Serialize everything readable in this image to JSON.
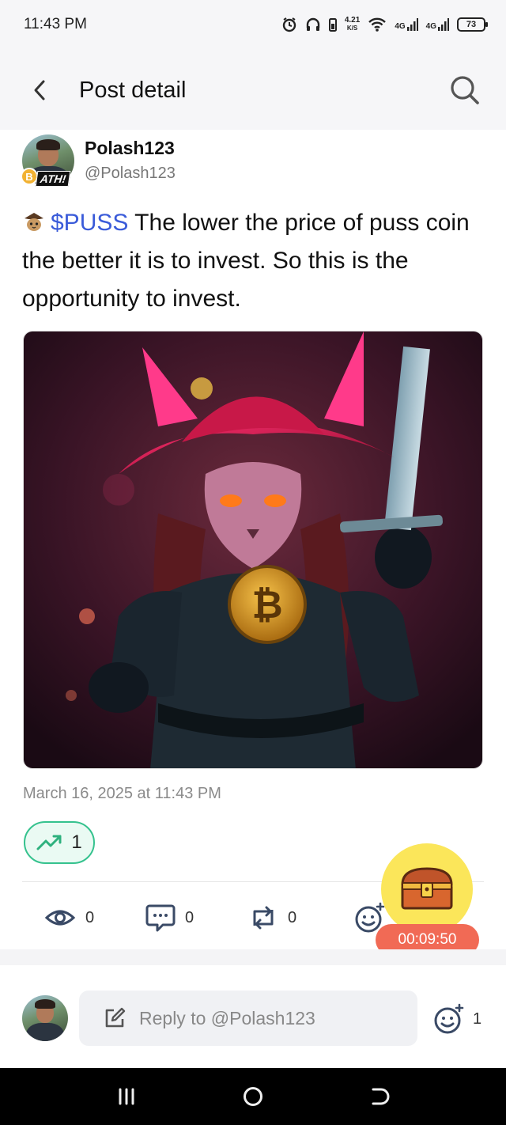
{
  "status_bar": {
    "time": "11:43 PM",
    "net_speed_value": "4.21",
    "net_speed_unit": "K/S",
    "sim1": "4G",
    "sim2": "4G",
    "battery": "73"
  },
  "header": {
    "title": "Post detail"
  },
  "post": {
    "author_name": "Polash123",
    "author_handle": "@Polash123",
    "badge_label": "ATH!",
    "badge_coin": "B",
    "ticker": "$PUSS",
    "text": " The lower the price of puss coin the better it is to invest. So this is the opportunity to invest.",
    "date": "March 16, 2025 at 11:43 PM",
    "trend_count": "1"
  },
  "actions": {
    "views": "0",
    "comments": "0",
    "reposts": "0"
  },
  "floating": {
    "timer": "00:09:50"
  },
  "reply": {
    "placeholder": "Reply to @Polash123",
    "reaction_count": "1"
  },
  "colors": {
    "accent_blue": "#3a5bd9",
    "trend_green": "#35c28e",
    "timer_red": "#f16a55",
    "treasure_yellow": "#fbe65a"
  }
}
